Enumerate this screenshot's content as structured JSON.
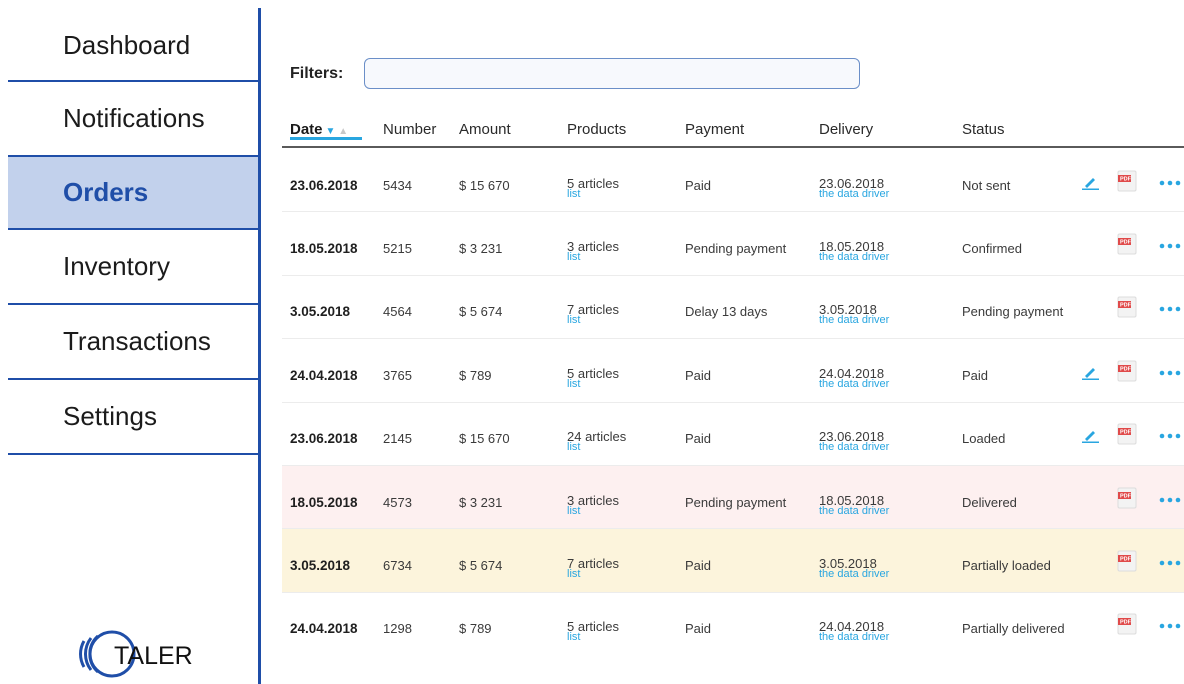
{
  "sidebar": {
    "items": [
      {
        "label": "Dashboard"
      },
      {
        "label": "Notifications"
      },
      {
        "label": "Orders",
        "active": true
      },
      {
        "label": "Inventory"
      },
      {
        "label": "Transactions"
      },
      {
        "label": "Settings"
      }
    ],
    "logo_text": "TALER"
  },
  "filters": {
    "label": "Filters:",
    "value": "",
    "placeholder": ""
  },
  "table": {
    "headers": {
      "date": "Date",
      "number": "Number",
      "amount": "Amount",
      "products": "Products",
      "payment": "Payment",
      "delivery": "Delivery",
      "status": "Status"
    },
    "sort": {
      "column": "date",
      "direction": "descending"
    },
    "rows": [
      {
        "date": "23.06.2018",
        "number": "5434",
        "amount": "$ 15 670",
        "products": "5 articles",
        "products_link": "list",
        "payment": "Paid",
        "delivery": "23.06.2018",
        "delivery_link": "the data driver",
        "status": "Not sent",
        "editable": true,
        "highlight": "none"
      },
      {
        "date": "18.05.2018",
        "number": "5215",
        "amount": "$ 3 231",
        "products": "3 articles",
        "products_link": "list",
        "payment": "Pending payment",
        "delivery": "18.05.2018",
        "delivery_link": "the data driver",
        "status": "Confirmed",
        "editable": false,
        "highlight": "none"
      },
      {
        "date": "3.05.2018",
        "number": "4564",
        "amount": "$ 5 674",
        "products": "7 articles",
        "products_link": "list",
        "payment": "Delay 13 days",
        "delivery": "3.05.2018",
        "delivery_link": "the data driver",
        "status": "Pending payment",
        "editable": false,
        "highlight": "none"
      },
      {
        "date": "24.04.2018",
        "number": "3765",
        "amount": "$ 789",
        "products": "5 articles",
        "products_link": "list",
        "payment": "Paid",
        "delivery": "24.04.2018",
        "delivery_link": "the data driver",
        "status": "Paid",
        "editable": true,
        "highlight": "none"
      },
      {
        "date": "23.06.2018",
        "number": "2145",
        "amount": "$ 15 670",
        "products": "24 articles",
        "products_link": "list",
        "payment": "Paid",
        "delivery": "23.06.2018",
        "delivery_link": "the data driver",
        "status": "Loaded",
        "editable": true,
        "highlight": "none"
      },
      {
        "date": "18.05.2018",
        "number": "4573",
        "amount": "$ 3 231",
        "products": "3 articles",
        "products_link": "list",
        "payment": "Pending payment",
        "delivery": "18.05.2018",
        "delivery_link": "the data driver",
        "status": "Delivered",
        "editable": false,
        "highlight": "pink"
      },
      {
        "date": "3.05.2018",
        "number": "6734",
        "amount": "$ 5 674",
        "products": "7 articles",
        "products_link": "list",
        "payment": "Paid",
        "delivery": "3.05.2018",
        "delivery_link": "the data driver",
        "status": "Partially loaded",
        "editable": false,
        "highlight": "yellow"
      },
      {
        "date": "24.04.2018",
        "number": "1298",
        "amount": "$ 789",
        "products": "5 articles",
        "products_link": "list",
        "payment": "Paid",
        "delivery": "24.04.2018",
        "delivery_link": "the data driver",
        "status": "Partially delivered",
        "editable": false,
        "highlight": "none"
      }
    ]
  },
  "icons": {
    "edit": "edit-pencil-icon",
    "pdf": "pdf-file-icon",
    "more": "more-dots-icon",
    "sort": "sort-arrow-icon"
  },
  "colors": {
    "accent": "#29a6e0",
    "brand": "#1f4ea8",
    "active_bg": "#c2d1ec",
    "pink_row": "#fdf0f0",
    "yellow_row": "#fcf4dc",
    "pdf_red": "#e04a4a"
  }
}
